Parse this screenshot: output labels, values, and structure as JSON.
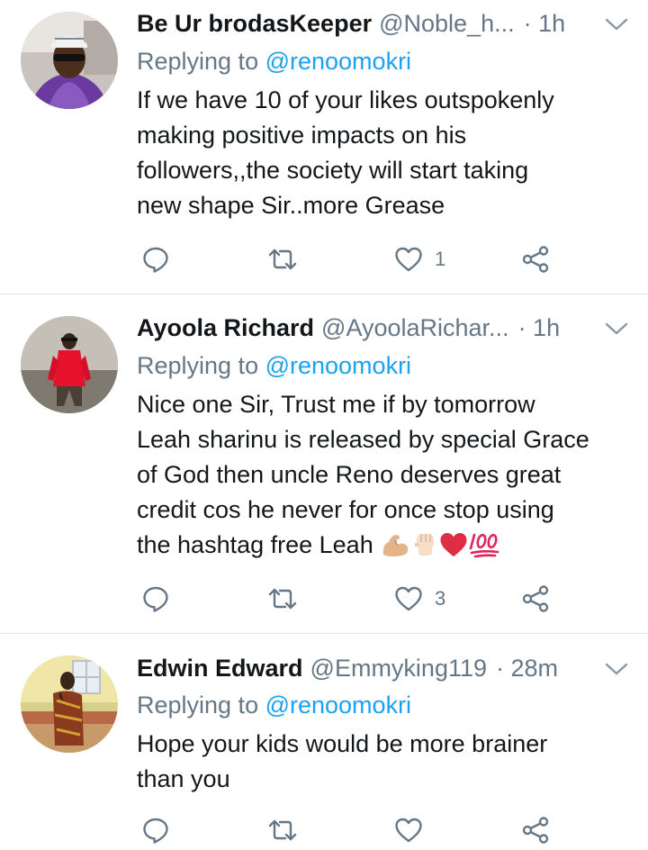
{
  "tweets": [
    {
      "name": "Be Ur brodasKeeper",
      "handle": "@Noble_h...",
      "time": "· 1h",
      "replying_prefix": "Replying to ",
      "replying_mention": "@renoomokri",
      "text_lines": [
        "If we have 10 of your likes outspokenly",
        "making positive impacts on his",
        "followers,,the society will start taking",
        "new shape Sir..more Grease"
      ],
      "like_count": "1"
    },
    {
      "name": "Ayoola Richard",
      "handle": "@AyoolaRichar...",
      "time": "· 1h",
      "replying_prefix": "Replying to ",
      "replying_mention": "@renoomokri",
      "text_lines": [
        "Nice one Sir, Trust me if by tomorrow",
        "Leah sharinu is released by special Grace",
        "of God then uncle Reno deserves great",
        "credit cos he never for once stop using",
        "the hashtag free Leah "
      ],
      "emojis": [
        "💪🏼",
        "✊🏻",
        "❤️",
        "💯"
      ],
      "like_count": "3"
    },
    {
      "name": "Edwin Edward",
      "handle": "@Emmyking119",
      "time": "· 28m",
      "replying_prefix": "Replying to ",
      "replying_mention": "@renoomokri",
      "text_lines": [
        "Hope your kids would be more brainer",
        "than you"
      ],
      "like_count": ""
    }
  ],
  "icons": {
    "reply": "comment-bubble-icon",
    "retweet": "retweet-icon",
    "like": "heart-icon",
    "share": "share-icon",
    "menu": "chevron-down-icon"
  },
  "colors": {
    "link": "#1da1f2",
    "secondary": "#657786",
    "divider": "#e1e8ed",
    "heart_emoji": "#dd2e44",
    "hundred_emoji": "#e0245e"
  }
}
